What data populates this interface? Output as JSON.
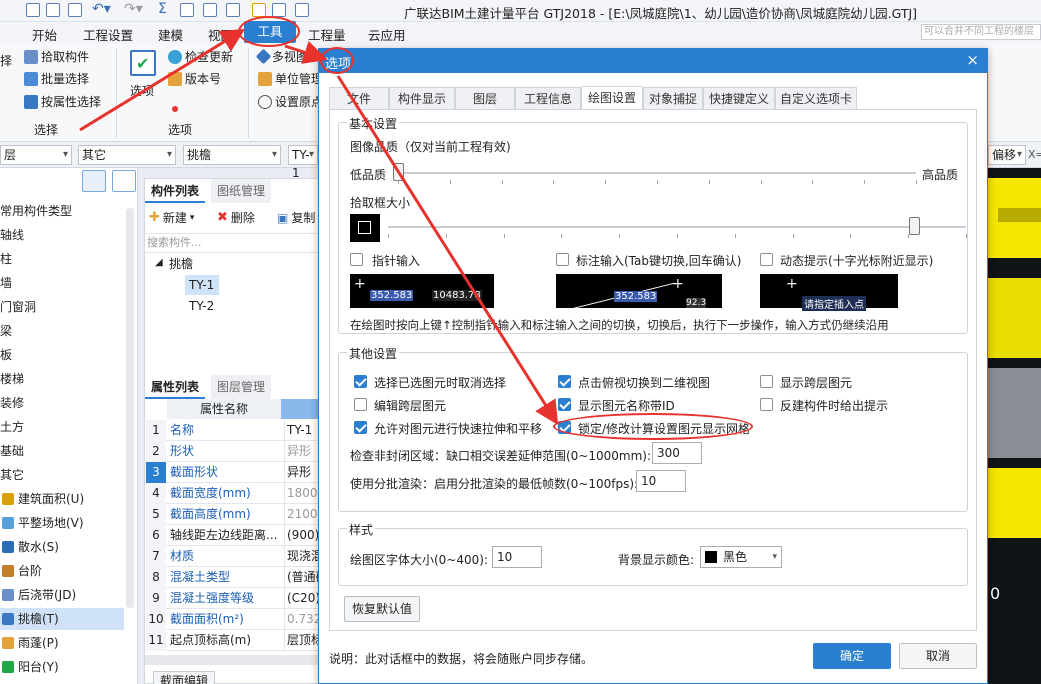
{
  "app": {
    "title": "广联达BIM土建计量平台 GTJ2018 - [E:\\凤城庭院\\1、幼儿园\\造价协商\\凤城庭院幼儿园.GTJ]"
  },
  "menu": {
    "items": [
      "开始",
      "工程设置",
      "建模",
      "视图",
      "工具",
      "工程量",
      "云应用"
    ],
    "search_placeholder": "可以合并不同工程的楼层"
  },
  "ribbon": {
    "pick_component": "拾取构件",
    "batch_select": "批量选择",
    "select_by_attr": "按属性选择",
    "select_group": "选择",
    "options": "选项",
    "check_update": "检查更新",
    "version": "版本号",
    "options_group": "选项",
    "multi_view": "多视图",
    "unit_manage": "单位管理",
    "set_origin": "设置原点",
    "left_cut": "择"
  },
  "filterbar": {
    "floor": "层",
    "category": "其它",
    "type": "挑檐",
    "component": "TY-1",
    "right_combo": "偏移",
    "right_text": "X="
  },
  "left_tree": {
    "items": [
      "常用构件类型",
      "轴线",
      "柱",
      "墙",
      "门窗洞",
      "梁",
      "板",
      "楼梯",
      "装修",
      "土方",
      "基础",
      "其它",
      "建筑面积(U)",
      "平整场地(V)",
      "散水(S)",
      "台阶",
      "后浇带(JD)",
      "挑檐(T)",
      "雨蓬(P)",
      "阳台(Y)"
    ]
  },
  "component_panel": {
    "tab_list": "构件列表",
    "tab_drawing": "图纸管理",
    "new": "新建",
    "delete": "删除",
    "copy": "复制",
    "search_placeholder": "搜索构件...",
    "group": "挑檐",
    "items": [
      "TY-1",
      "TY-2"
    ]
  },
  "props_panel": {
    "tab_props": "属性列表",
    "tab_layers": "图层管理",
    "header_name": "属性名称",
    "rows": [
      {
        "n": "1",
        "name": "名称",
        "val": "TY-1"
      },
      {
        "n": "2",
        "name": "形状",
        "val": "异形"
      },
      {
        "n": "3",
        "name": "截面形状",
        "val": "异形"
      },
      {
        "n": "4",
        "name": "截面宽度(mm)",
        "val": "1800"
      },
      {
        "n": "5",
        "name": "截面高度(mm)",
        "val": "2100"
      },
      {
        "n": "6",
        "name": "轴线距左边线距离...",
        "val": "(900)"
      },
      {
        "n": "7",
        "name": "材质",
        "val": "现浇混"
      },
      {
        "n": "8",
        "name": "混凝土类型",
        "val": "(普通砼"
      },
      {
        "n": "9",
        "name": "混凝土强度等级",
        "val": "(C20)"
      },
      {
        "n": "10",
        "name": "截面面积(m²)",
        "val": "0.732"
      },
      {
        "n": "11",
        "name": "起点顶标高(m)",
        "val": "层顶标"
      }
    ],
    "bottom_tab": "截面编辑"
  },
  "dialog": {
    "title": "选项",
    "close": "×",
    "tabs": [
      "文件",
      "构件显示",
      "图层",
      "工程信息",
      "绘图设置",
      "对象捕捉",
      "快捷键定义",
      "自定义选项卡"
    ],
    "active_tab": "绘图设置",
    "basic": {
      "title": "基本设置",
      "quality_label": "图像品质（仅对当前工程有效)",
      "quality_low": "低品质",
      "quality_high": "高品质",
      "quality_level": 0.0,
      "pickbox_label": "拾取框大小",
      "pickbox_level": 0.91,
      "pointer_input": "指针输入",
      "dim_input": "标注输入(Tab键切换,回车确认)",
      "dynamic_hint": "动态提示(十字光标附近显示)",
      "preview1_a": "352.583",
      "preview1_b": "10483.78",
      "preview2_a": "352.583",
      "preview2_b": "92.3",
      "preview3": "请指定插入点",
      "note": "在绘图时按向上键↑控制指针输入和标注输入之间的切换，切换后，执行下一步操作，输入方式仍继续沿用"
    },
    "other": {
      "title": "其他设置",
      "opt1": "选择已选图元时取消选择",
      "opt2": "点击俯视切换到二维视图",
      "opt3": "显示跨层图元",
      "opt4": "编辑跨层图元",
      "opt5": "显示图元名称带ID",
      "opt6": "反建构件时给出提示",
      "opt7": "允许对图元进行快速拉伸和平移",
      "opt8": "锁定/修改计算设置图元显示网格",
      "gap_label": "检查非封闭区域：缺口相交误差延伸范围(0~1000mm):",
      "gap_value": "300",
      "batch_label": "使用分批渲染：启用分批渲染的最低帧数(0~100fps):",
      "batch_value": "10"
    },
    "style": {
      "title": "样式",
      "font_label": "绘图区字体大小(0~400):",
      "font_value": "10",
      "bg_label": "背景显示颜色:",
      "bg_value": "黑色"
    },
    "restore": "恢复默认值",
    "footer_note": "说明：此对话框中的数据，将会随账户同步存储。",
    "ok": "确定",
    "cancel": "取消"
  },
  "view3d": {
    "label": "0"
  },
  "colors": {
    "accent": "#2a7fd0",
    "annotation": "#e8322d",
    "yellow": "#f5e600"
  }
}
